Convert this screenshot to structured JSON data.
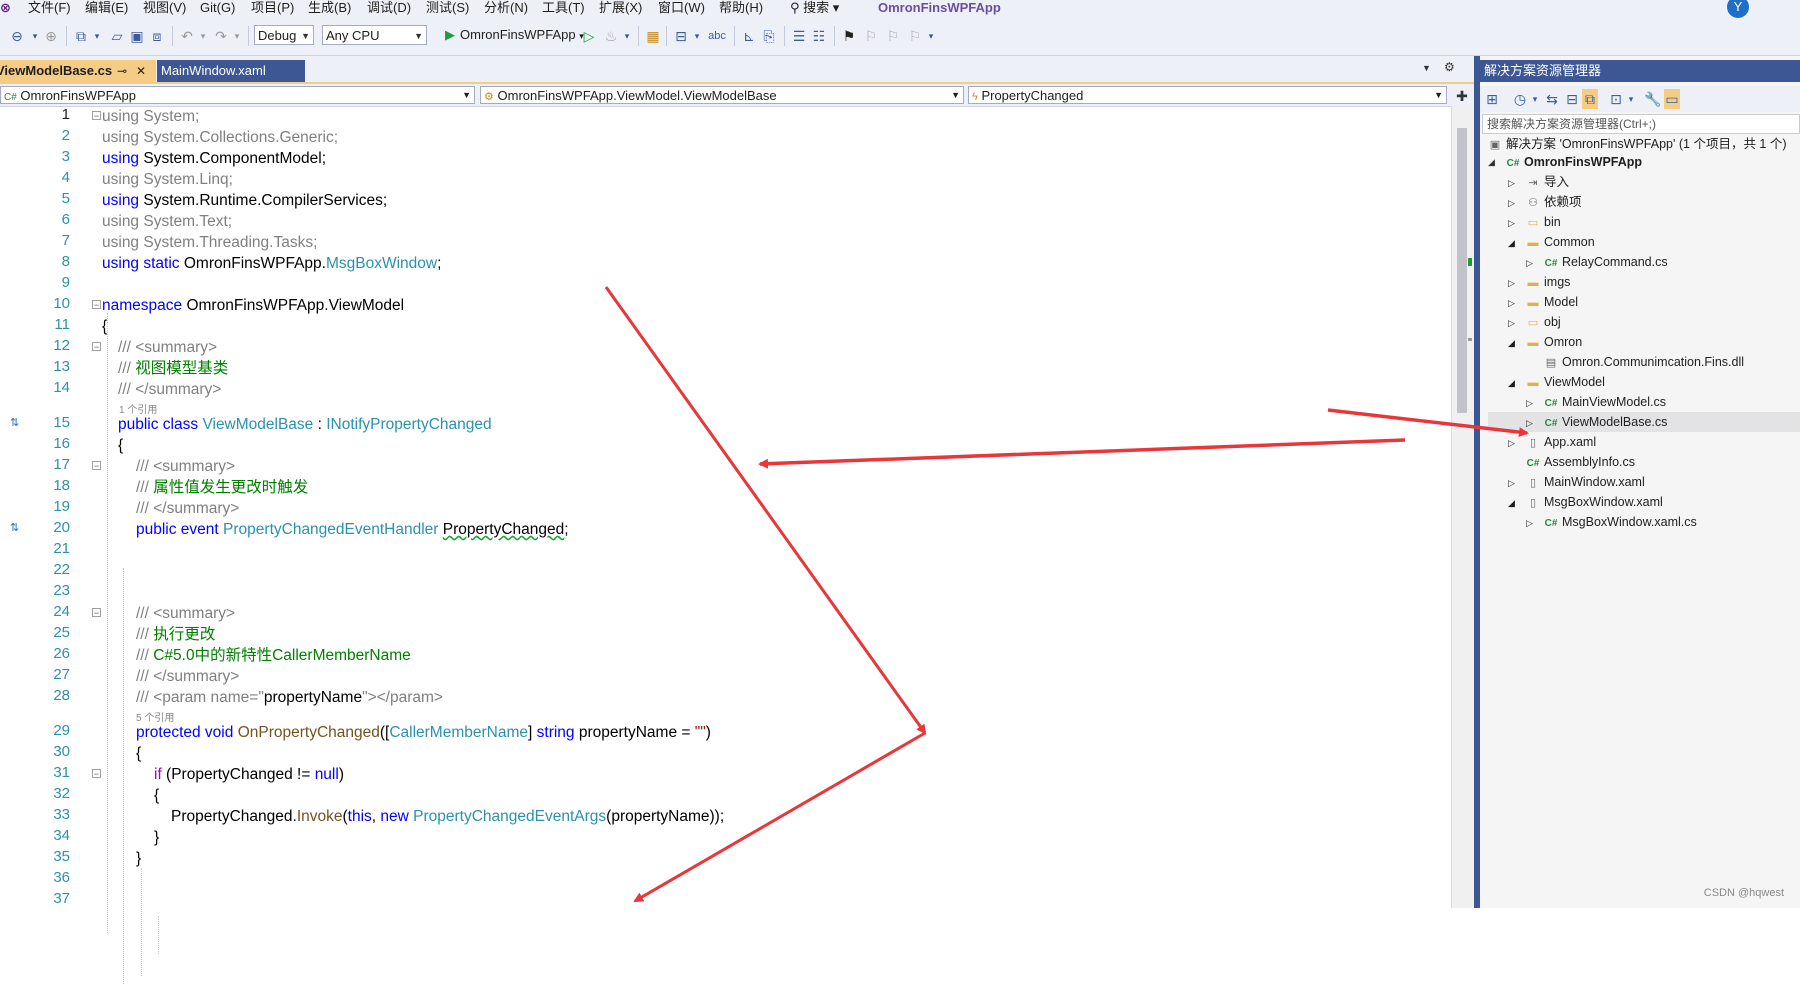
{
  "menu": {
    "logo": "⊗",
    "items": [
      "文件(F)",
      "编辑(E)",
      "视图(V)",
      "Git(G)",
      "项目(P)",
      "生成(B)",
      "调试(D)",
      "测试(S)",
      "分析(N)",
      "工具(T)",
      "扩展(X)",
      "窗口(W)",
      "帮助(H)"
    ],
    "search_label": "搜索",
    "app_title": "OmronFinsWPFApp",
    "account_initial": "Y"
  },
  "toolbar": {
    "config": "Debug",
    "platform": "Any CPU",
    "run_label": "OmronFinsWPFApp"
  },
  "tabs": {
    "active": "ViewModelBase.cs",
    "active_pin": "⊸",
    "active_close": "✕",
    "inactive": "MainWindow.xaml"
  },
  "navbar": {
    "project": "OmronFinsWPFApp",
    "type": "OmronFinsWPFApp.ViewModel.ViewModelBase",
    "member": "PropertyChanged"
  },
  "code": {
    "line_numbers": [
      "1",
      "2",
      "3",
      "4",
      "5",
      "6",
      "7",
      "8",
      "9",
      "10",
      "11",
      "12",
      "13",
      "14",
      "15",
      "16",
      "17",
      "18",
      "19",
      "20",
      "21",
      "22",
      "23",
      "24",
      "25",
      "26",
      "27",
      "28",
      "29",
      "30",
      "31",
      "32",
      "33",
      "34",
      "35",
      "36",
      "37"
    ],
    "l1": "using System;",
    "l2": "using System.Collections.Generic;",
    "l3_kw": "using",
    "l3_rest": " System.ComponentModel;",
    "l4": "using System.Linq;",
    "l5_kw": "using",
    "l5_rest": " System.Runtime.CompilerServices;",
    "l6": "using System.Text;",
    "l7": "using System.Threading.Tasks;",
    "l8_kw": "using static",
    "l8_ns": " OmronFinsWPFApp.",
    "l8_ty": "MsgBoxWindow",
    "l8_end": ";",
    "l10_kw": "namespace",
    "l10_rest": " OmronFinsWPFApp.ViewModel",
    "l11": "{",
    "l12_dc": "/// <summary>",
    "l13_dc": "/// ",
    "l13_cm": "视图模型基类",
    "l14_dc": "/// </summary>",
    "lens_class": "1 个引用",
    "l15_kw": "public class",
    "l15_ty": "ViewModelBase",
    "l15_colon": " : ",
    "l15_if": "INotifyPropertyChanged",
    "l16": "{",
    "l17_dc": "/// <summary>",
    "l18_dc": "/// ",
    "l18_cm": "属性值发生更改时触发",
    "l19_dc": "/// </summary>",
    "l20_kw": "public event",
    "l20_ty": "PropertyChangedEventHandler",
    "l20_name": "PropertyChanged",
    "l20_end": ";",
    "l24_dc": "/// <summary>",
    "l25_dc": "/// ",
    "l25_cm": "执行更改",
    "l26_dc": "/// ",
    "l26_cm": "C#5.0中的新特性CallerMemberName",
    "l27_dc": "/// </summary>",
    "l28_dc": "/// <param name=\"",
    "l28_pn": "propertyName",
    "l28_dc2": "\"></param>",
    "lens_method": "5 个引用",
    "l29_kw": "protected void",
    "l29_mt": "OnPropertyChanged",
    "l29_p1": "([",
    "l29_attr": "CallerMemberName",
    "l29_p2": "] ",
    "l29_kw2": "string",
    "l29_p3": " propertyName = ",
    "l29_str": "\"\"",
    "l29_p4": ")",
    "l30": "{",
    "l31_kw": "if",
    "l31_p": " (PropertyChanged != ",
    "l31_null": "null",
    "l31_end": ")",
    "l32": "{",
    "l33_a": "PropertyChanged.",
    "l33_mt": "Invoke",
    "l33_b": "(",
    "l33_this": "this",
    "l33_c": ", ",
    "l33_new": "new",
    "l33_ty": " PropertyChangedEventArgs",
    "l33_d": "(propertyName));",
    "l34": "}",
    "l35": "}"
  },
  "solution_explorer": {
    "title": "解决方案资源管理器",
    "search_placeholder": "搜索解决方案资源管理器(Ctrl+;)",
    "solution": "解决方案 'OmronFinsWPFApp' (1 个项目，共 1 个)",
    "project": "OmronFinsWPFApp",
    "items": [
      {
        "label": "导入",
        "icon": "import-icon",
        "glyph": "⇥",
        "expander": "▷",
        "level": 1
      },
      {
        "label": "依赖项",
        "icon": "dependencies-icon",
        "glyph": "⚇",
        "expander": "▷",
        "level": 1
      },
      {
        "label": "bin",
        "icon": "folder-icon",
        "glyph": "▭",
        "expander": "▷",
        "level": 1
      },
      {
        "label": "Common",
        "icon": "folder-icon",
        "glyph": "▬",
        "expander": "◢",
        "level": 1
      },
      {
        "label": "RelayCommand.cs",
        "icon": "csharp-file-icon",
        "glyph": "C#",
        "expander": "▷",
        "level": 2
      },
      {
        "label": "imgs",
        "icon": "folder-icon",
        "glyph": "▬",
        "expander": "▷",
        "level": 1
      },
      {
        "label": "Model",
        "icon": "folder-icon",
        "glyph": "▬",
        "expander": "▷",
        "level": 1
      },
      {
        "label": "obj",
        "icon": "folder-icon",
        "glyph": "▭",
        "expander": "▷",
        "level": 1
      },
      {
        "label": "Omron",
        "icon": "folder-icon",
        "glyph": "▬",
        "expander": "◢",
        "level": 1
      },
      {
        "label": "Omron.Communimcation.Fins.dll",
        "icon": "dll-icon",
        "glyph": "▤",
        "expander": "",
        "level": 2
      },
      {
        "label": "ViewModel",
        "icon": "folder-icon",
        "glyph": "▬",
        "expander": "◢",
        "level": 1
      },
      {
        "label": "MainViewModel.cs",
        "icon": "csharp-file-icon",
        "glyph": "C#",
        "expander": "▷",
        "level": 2
      },
      {
        "label": "ViewModelBase.cs",
        "icon": "csharp-file-icon",
        "glyph": "C#",
        "expander": "▷",
        "level": 2
      },
      {
        "label": "App.xaml",
        "icon": "xaml-file-icon",
        "glyph": "▯",
        "expander": "▷",
        "level": 1
      },
      {
        "label": "AssemblyInfo.cs",
        "icon": "csharp-file-icon",
        "glyph": "C#",
        "expander": "",
        "level": 1
      },
      {
        "label": "MainWindow.xaml",
        "icon": "xaml-file-icon",
        "glyph": "▯",
        "expander": "▷",
        "level": 1
      },
      {
        "label": "MsgBoxWindow.xaml",
        "icon": "xaml-file-icon",
        "glyph": "▯",
        "expander": "◢",
        "level": 1
      },
      {
        "label": "MsgBoxWindow.xaml.cs",
        "icon": "csharp-file-icon",
        "glyph": "C#",
        "expander": "▷",
        "level": 2
      }
    ]
  },
  "watermark": "CSDN @hqwest",
  "colors": {
    "arrow": "#e8363a",
    "accent": "#3c5793",
    "active_tab": "#f5cc84"
  }
}
